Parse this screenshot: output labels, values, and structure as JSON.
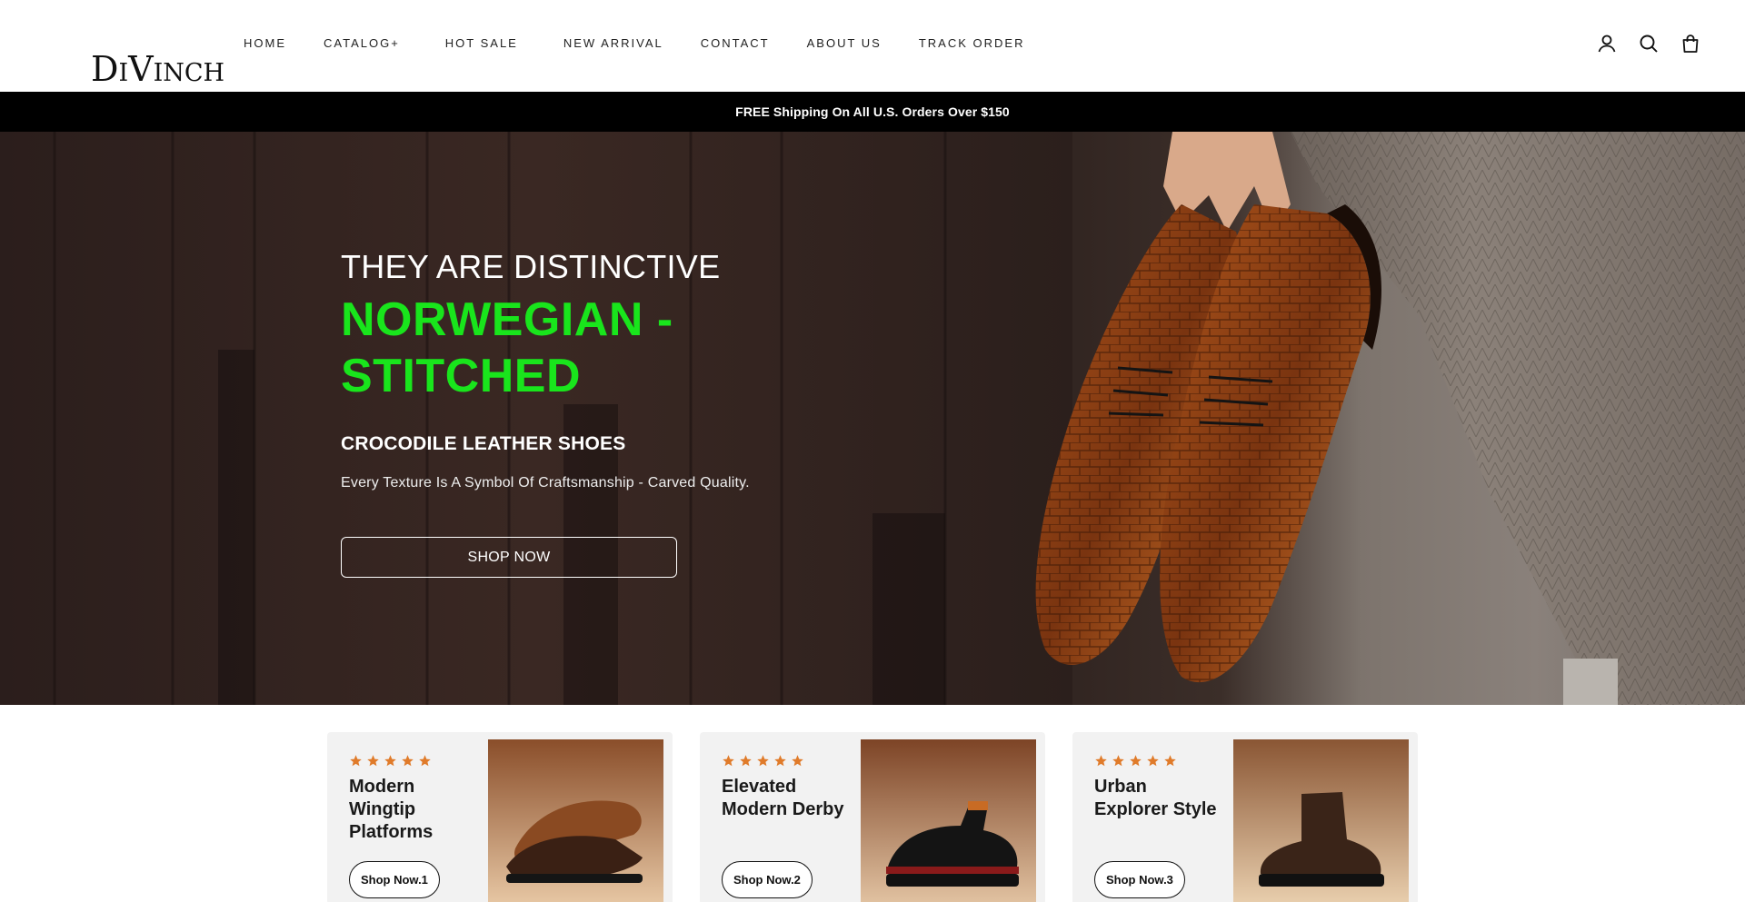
{
  "header": {
    "logo": "DiVinch",
    "nav": [
      {
        "label": "HOME"
      },
      {
        "label": "CATALOG+"
      },
      {
        "label": "HOT SALE"
      },
      {
        "label": "NEW ARRIVAL"
      },
      {
        "label": "CONTACT"
      },
      {
        "label": "ABOUT US"
      },
      {
        "label": "TRACK ORDER"
      }
    ],
    "icons": [
      "account-icon",
      "search-icon",
      "cart-bag-icon"
    ]
  },
  "announcement": {
    "text": "FREE Shipping On All U.S. Orders Over $150"
  },
  "hero": {
    "line1": "THEY ARE DISTINCTIVE",
    "title_line1": "NORWEGIAN -",
    "title_line2": "STITCHED",
    "subtitle": "CROCODILE LEATHER SHOES",
    "description": "Every Texture Is A Symbol Of Craftsmanship - Carved Quality.",
    "button": "SHOP NOW",
    "title_color": "#19e51c"
  },
  "cards": [
    {
      "title": "Modern Wingtip Platforms",
      "button": "Shop Now.1",
      "rating": 5
    },
    {
      "title": "Elevated Modern Derby",
      "button": "Shop Now.2",
      "rating": 5
    },
    {
      "title": "Urban Explorer Style",
      "button": "Shop Now.3",
      "rating": 5
    }
  ],
  "colors": {
    "star": "#e07b2a",
    "announcement_bg": "#000000"
  }
}
